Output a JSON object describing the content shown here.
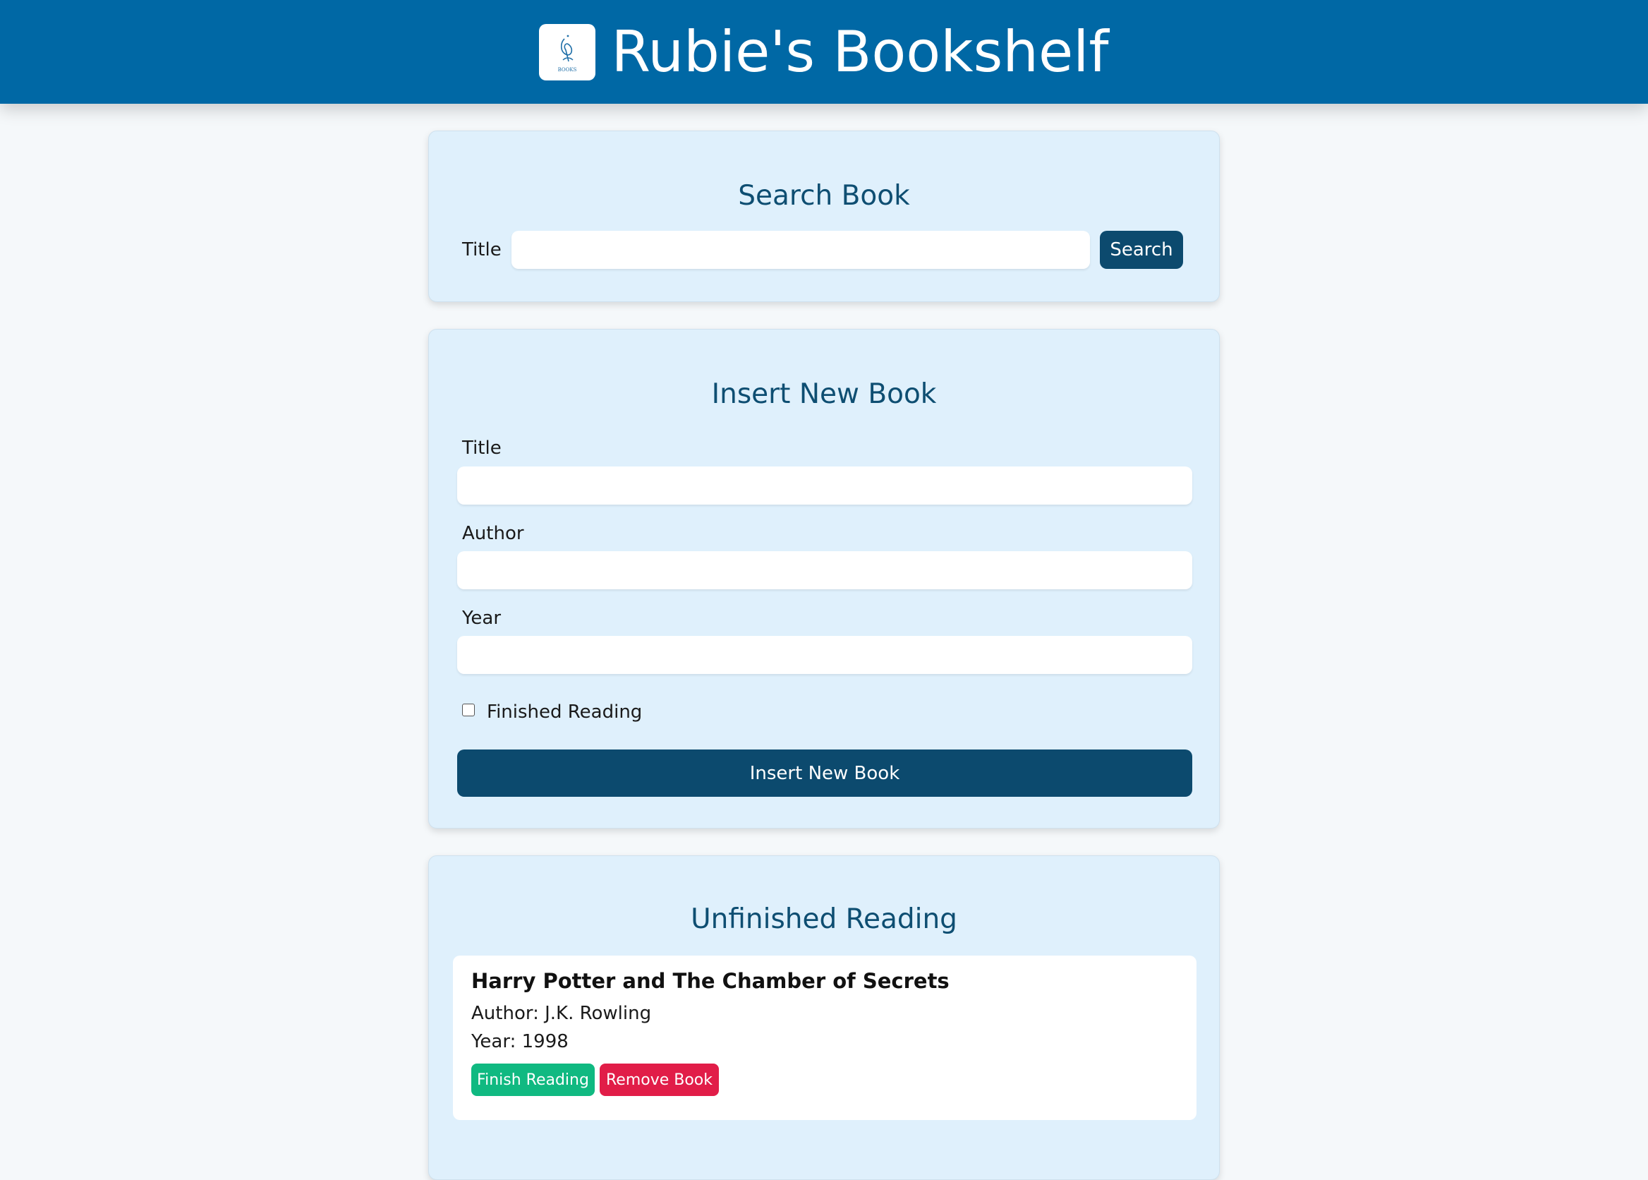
{
  "header": {
    "title": "Rubie's Bookshelf",
    "logo_icon": "books-logo-icon",
    "logo_text": "BOOKS",
    "bg_color": "#0068a5"
  },
  "search": {
    "heading": "Search Book",
    "title_label": "Title",
    "title_value": "",
    "button_label": "Search"
  },
  "insert": {
    "heading": "Insert New Book",
    "title_label": "Title",
    "title_value": "",
    "author_label": "Author",
    "author_value": "",
    "year_label": "Year",
    "year_value": "",
    "finished_label": "Finished Reading",
    "finished_checked": false,
    "submit_label": "Insert New Book"
  },
  "unfinished": {
    "heading": "Unfinished Reading",
    "books": [
      {
        "title": "Harry Potter and The Chamber of Secrets",
        "author": "Author: J.K. Rowling",
        "year": "Year: 1998",
        "finish_label": "Finish Reading",
        "remove_label": "Remove Book"
      }
    ]
  },
  "colors": {
    "accent_dark": "#0c4a6e",
    "finish_green": "#10b981",
    "remove_red": "#e11d48",
    "card_bg": "#dff0fc"
  }
}
